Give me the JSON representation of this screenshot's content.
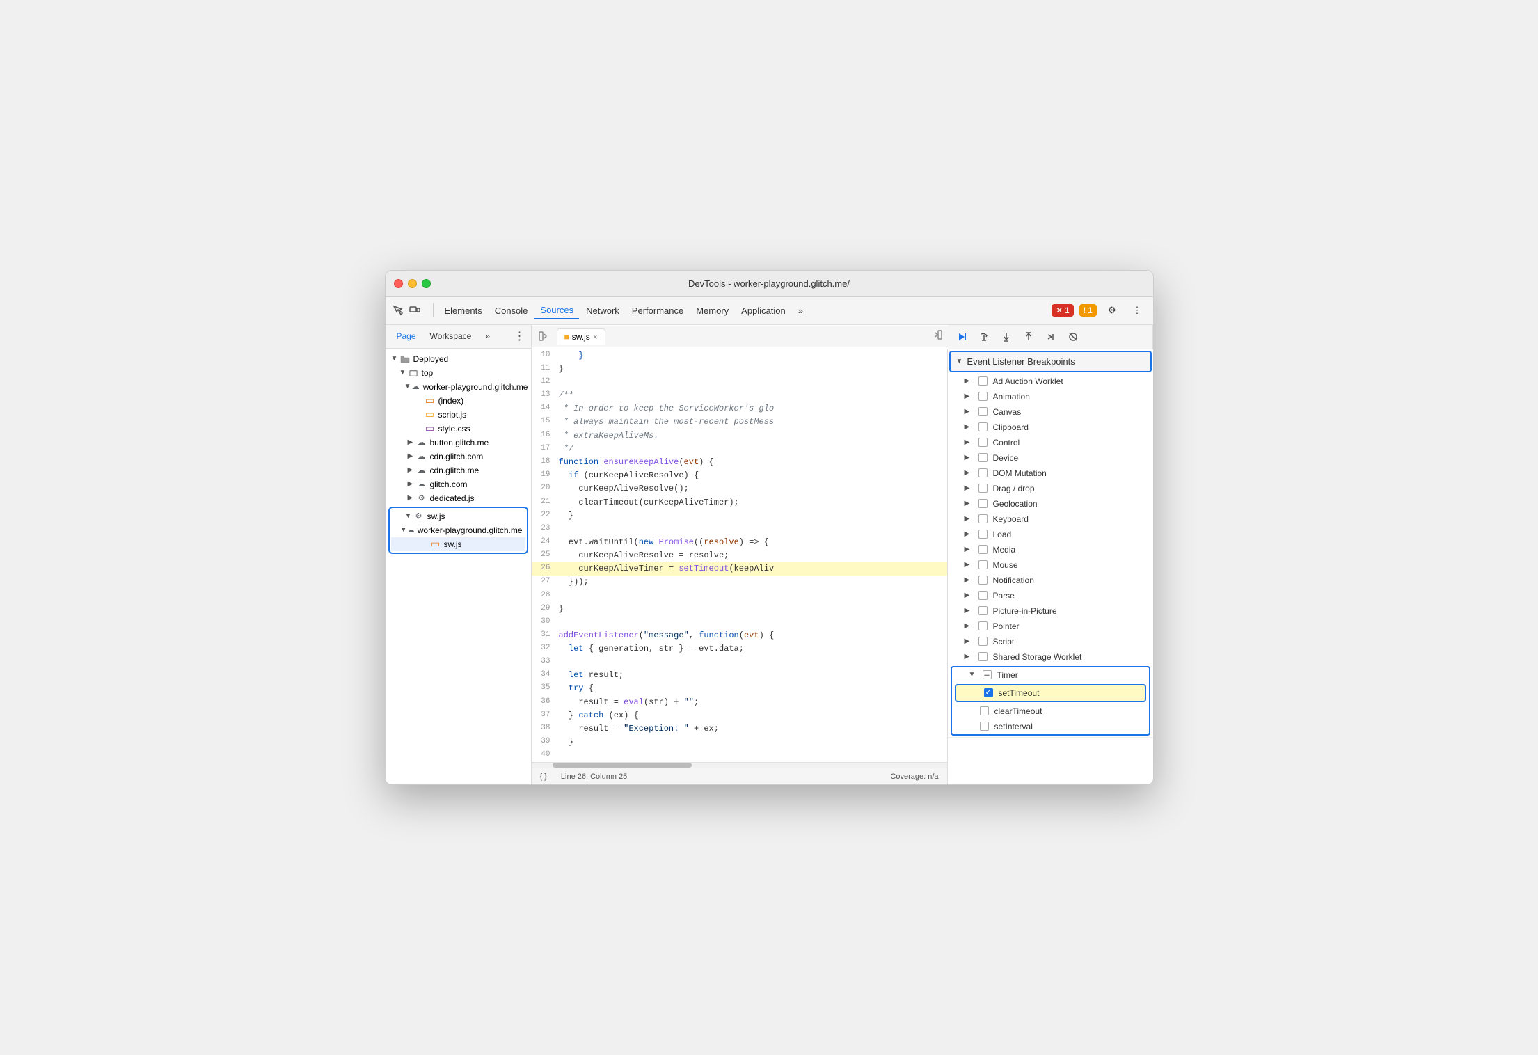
{
  "window": {
    "title": "DevTools - worker-playground.glitch.me/"
  },
  "toolbar": {
    "tabs": [
      {
        "label": "Elements",
        "active": false
      },
      {
        "label": "Console",
        "active": false
      },
      {
        "label": "Sources",
        "active": true
      },
      {
        "label": "Network",
        "active": false
      },
      {
        "label": "Performance",
        "active": false
      },
      {
        "label": "Memory",
        "active": false
      },
      {
        "label": "Application",
        "active": false
      }
    ],
    "more_label": "»",
    "error_count": "1",
    "warning_count": "1",
    "settings_label": "⚙",
    "more_options_label": "⋮"
  },
  "secondary_toolbar": {
    "tabs": [
      {
        "label": "Page",
        "active": true
      },
      {
        "label": "Workspace",
        "active": false
      }
    ],
    "more_label": "»"
  },
  "file_tree": {
    "items": [
      {
        "id": "deployed",
        "label": "Deployed",
        "level": 0,
        "type": "folder",
        "open": true
      },
      {
        "id": "top",
        "label": "top",
        "level": 1,
        "type": "folder",
        "open": true
      },
      {
        "id": "worker-playground-1",
        "label": "worker-playground.glitch.me",
        "level": 2,
        "type": "cloud",
        "open": true
      },
      {
        "id": "index",
        "label": "(index)",
        "level": 3,
        "type": "file-html"
      },
      {
        "id": "script-js",
        "label": "script.js",
        "level": 3,
        "type": "file-js"
      },
      {
        "id": "style-css",
        "label": "style.css",
        "level": 3,
        "type": "file-css"
      },
      {
        "id": "button-glitch",
        "label": "button.glitch.me",
        "level": 2,
        "type": "cloud",
        "open": false
      },
      {
        "id": "cdn-glitch-com",
        "label": "cdn.glitch.com",
        "level": 2,
        "type": "cloud",
        "open": false
      },
      {
        "id": "cdn-glitch-me",
        "label": "cdn.glitch.me",
        "level": 2,
        "type": "cloud",
        "open": false
      },
      {
        "id": "glitch-com",
        "label": "glitch.com",
        "level": 2,
        "type": "cloud",
        "open": false
      },
      {
        "id": "dedicated-js",
        "label": "dedicated.js",
        "level": 2,
        "type": "file-gear"
      },
      {
        "id": "sw-js-parent",
        "label": "sw.js",
        "level": 1,
        "type": "file-gear",
        "open": true,
        "highlighted": true
      },
      {
        "id": "worker-playground-2",
        "label": "worker-playground.glitch.me",
        "level": 2,
        "type": "cloud",
        "open": true,
        "highlighted": true
      },
      {
        "id": "sw-js-child",
        "label": "sw.js",
        "level": 3,
        "type": "file-js",
        "highlighted": true,
        "selected": true
      }
    ]
  },
  "editor": {
    "active_tab": "sw.js",
    "lines": [
      {
        "num": 10,
        "content": "    }"
      },
      {
        "num": 11,
        "content": "}"
      },
      {
        "num": 12,
        "content": ""
      },
      {
        "num": 13,
        "content": "/**",
        "type": "comment"
      },
      {
        "num": 14,
        "content": " * In order to keep the ServiceWorker's glo",
        "type": "comment"
      },
      {
        "num": 15,
        "content": " * always maintain the most-recent postMess",
        "type": "comment"
      },
      {
        "num": 16,
        "content": " * extraKeepAliveMs.",
        "type": "comment"
      },
      {
        "num": 17,
        "content": " */",
        "type": "comment"
      },
      {
        "num": 18,
        "content": "function ensureKeepAlive(evt) {",
        "type": "fn-def"
      },
      {
        "num": 19,
        "content": "  if (curKeepAliveResolve) {",
        "type": "if"
      },
      {
        "num": 20,
        "content": "    curKeepAliveResolve();"
      },
      {
        "num": 21,
        "content": "    clearTimeout(curKeepAliveTimer);"
      },
      {
        "num": 22,
        "content": "  }"
      },
      {
        "num": 23,
        "content": ""
      },
      {
        "num": 24,
        "content": "  evt.waitUntil(new Promise((resolve) => {",
        "type": "promise"
      },
      {
        "num": 25,
        "content": "    curKeepAliveResolve = resolve;"
      },
      {
        "num": 26,
        "content": "    curKeepAliveTimer = setTimeout(keepAliv",
        "highlighted": true
      },
      {
        "num": 27,
        "content": "  }));"
      },
      {
        "num": 28,
        "content": ""
      },
      {
        "num": 29,
        "content": "}"
      },
      {
        "num": 30,
        "content": ""
      },
      {
        "num": 31,
        "content": "addEventListener(\"message\", function(evt) {",
        "type": "listener"
      },
      {
        "num": 32,
        "content": "  let { generation, str } = evt.data;"
      },
      {
        "num": 33,
        "content": ""
      },
      {
        "num": 34,
        "content": "  let result;"
      },
      {
        "num": 35,
        "content": "  try {"
      },
      {
        "num": 36,
        "content": "    result = eval(str) + \"\";"
      },
      {
        "num": 37,
        "content": "  } catch (ex) {"
      },
      {
        "num": 38,
        "content": "    result = \"Exception: \" + ex;"
      },
      {
        "num": 39,
        "content": "  }"
      },
      {
        "num": 40,
        "content": ""
      }
    ],
    "status_bar": {
      "format_label": "{ }",
      "position": "Line 26, Column 25",
      "coverage": "Coverage: n/a"
    }
  },
  "breakpoints": {
    "section_title": "Event Listener Breakpoints",
    "items": [
      {
        "label": "Ad Auction Worklet",
        "checked": false,
        "expanded": false
      },
      {
        "label": "Animation",
        "checked": false,
        "expanded": false
      },
      {
        "label": "Canvas",
        "checked": false,
        "expanded": false
      },
      {
        "label": "Clipboard",
        "checked": false,
        "expanded": false
      },
      {
        "label": "Control",
        "checked": false,
        "expanded": false
      },
      {
        "label": "Device",
        "checked": false,
        "expanded": false
      },
      {
        "label": "DOM Mutation",
        "checked": false,
        "expanded": false
      },
      {
        "label": "Drag / drop",
        "checked": false,
        "expanded": false
      },
      {
        "label": "Geolocation",
        "checked": false,
        "expanded": false
      },
      {
        "label": "Keyboard",
        "checked": false,
        "expanded": false
      },
      {
        "label": "Load",
        "checked": false,
        "expanded": false
      },
      {
        "label": "Media",
        "checked": false,
        "expanded": false
      },
      {
        "label": "Mouse",
        "checked": false,
        "expanded": false
      },
      {
        "label": "Notification",
        "checked": false,
        "expanded": false
      },
      {
        "label": "Parse",
        "checked": false,
        "expanded": false
      },
      {
        "label": "Picture-in-Picture",
        "checked": false,
        "expanded": false
      },
      {
        "label": "Pointer",
        "checked": false,
        "expanded": false
      },
      {
        "label": "Script",
        "checked": false,
        "expanded": false
      },
      {
        "label": "Shared Storage Worklet",
        "checked": false,
        "expanded": false
      },
      {
        "label": "Timer",
        "checked": false,
        "expanded": true,
        "highlighted": true
      }
    ],
    "timer_children": [
      {
        "label": "setTimeout",
        "checked": true,
        "highlighted": true
      },
      {
        "label": "clearTimeout",
        "checked": false
      },
      {
        "label": "setInterval",
        "checked": false
      }
    ]
  },
  "debug_controls": {
    "resume": "▶",
    "step_over": "↻",
    "step_into": "↓",
    "step_out": "↑",
    "step": "→",
    "deactivate": "⊘"
  },
  "colors": {
    "accent": "#1a73e8",
    "highlighted_bg": "#fff9c4",
    "error": "#d93025",
    "warning": "#f29900"
  }
}
